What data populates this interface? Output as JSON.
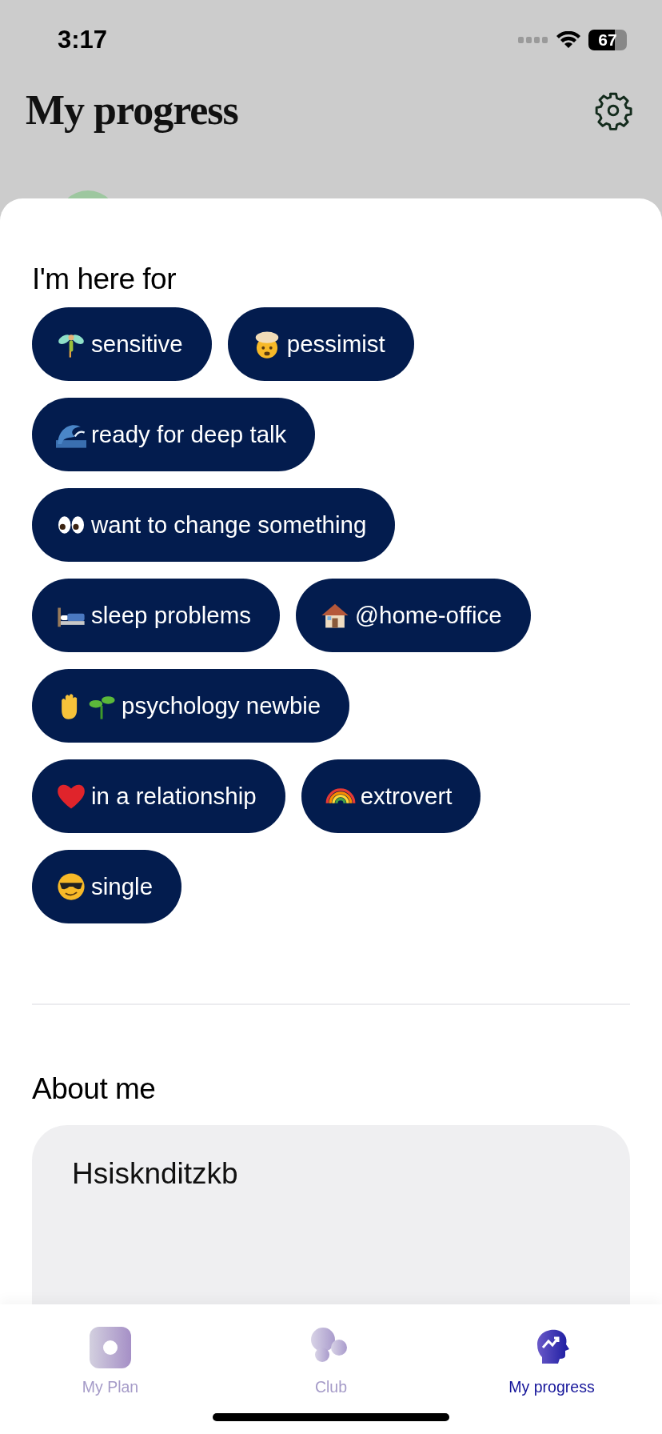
{
  "status_bar": {
    "time": "3:17",
    "battery": "67"
  },
  "header": {
    "title": "My progress"
  },
  "interests": {
    "title": "I'm here for",
    "rows": [
      [
        {
          "kind": "fairy",
          "label": "sensitive"
        },
        {
          "kind": "exploding-head",
          "label": "pessimist"
        }
      ],
      [
        {
          "kind": "wave",
          "label": "ready for deep talk"
        }
      ],
      [
        {
          "kind": "eyes",
          "label": "want to change something"
        }
      ],
      [
        {
          "kind": "bed",
          "label": "sleep problems"
        },
        {
          "kind": "house",
          "label": "@home-office"
        }
      ],
      [
        {
          "kind": "hand-seedling",
          "label": "psychology newbie"
        }
      ],
      [
        {
          "kind": "heart",
          "label": "in a relationship"
        },
        {
          "kind": "rainbow",
          "label": "extrovert"
        }
      ],
      [
        {
          "kind": "sunglasses",
          "label": "single"
        }
      ]
    ]
  },
  "about": {
    "title": "About me",
    "text": "Hsisknditzkb"
  },
  "tabs": [
    {
      "kind": "plan",
      "label": "My Plan",
      "selected": false
    },
    {
      "kind": "club",
      "label": "Club",
      "selected": false
    },
    {
      "kind": "progress",
      "label": "My progress",
      "selected": true
    }
  ]
}
